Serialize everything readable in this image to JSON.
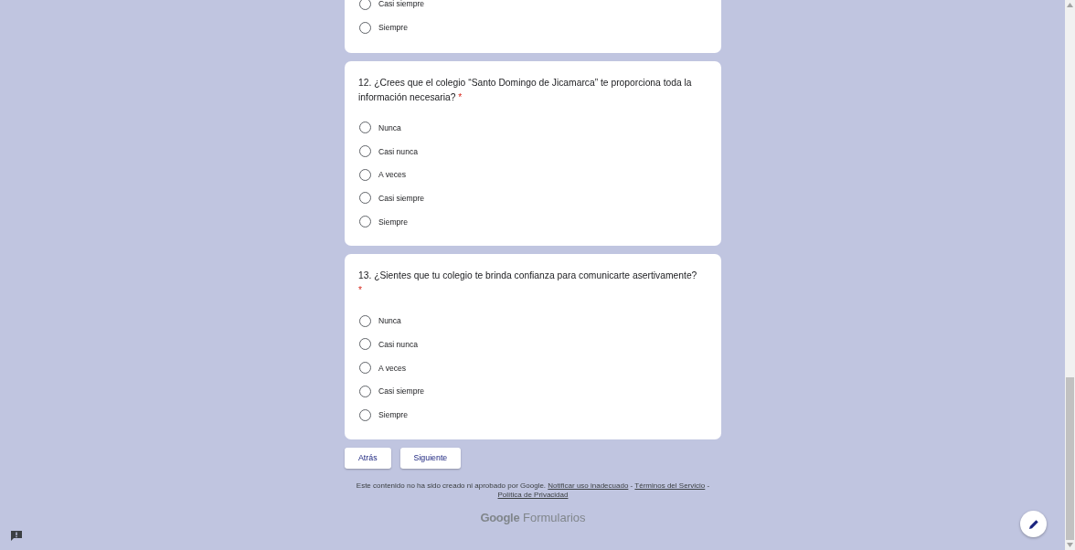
{
  "previous_question": {
    "options": [
      {
        "label": "Casi siempre",
        "selected": false
      },
      {
        "label": "Siempre",
        "selected": false
      }
    ]
  },
  "questions": [
    {
      "title": "12. ¿Crees que el colegio “Santo Domingo de Jicamarca” te proporciona toda la información necesaria?",
      "required_mark": "*",
      "options": [
        {
          "label": "Nunca",
          "selected": false
        },
        {
          "label": "Casi nunca",
          "selected": false
        },
        {
          "label": "A veces",
          "selected": false
        },
        {
          "label": "Casi siempre",
          "selected": false
        },
        {
          "label": "Siempre",
          "selected": false
        }
      ]
    },
    {
      "title": "13. ¿Sientes que tu colegio te brinda confianza para comunicarte asertivamente?",
      "required_mark": "*",
      "options": [
        {
          "label": "Nunca",
          "selected": false
        },
        {
          "label": "Casi nunca",
          "selected": false
        },
        {
          "label": "A veces",
          "selected": false
        },
        {
          "label": "Casi siempre",
          "selected": false
        },
        {
          "label": "Siempre",
          "selected": false
        }
      ]
    }
  ],
  "buttons": [
    "Atrás",
    "Siguiente"
  ],
  "footer": {
    "text": "Este contenido no ha sido creado ni aprobado por Google.",
    "links": [
      "Notificar uso inadecuado",
      "Términos del Servicio",
      "Política de Privacidad"
    ],
    "separator": "-"
  },
  "brand": {
    "google": "Google",
    "product": "Formularios"
  }
}
